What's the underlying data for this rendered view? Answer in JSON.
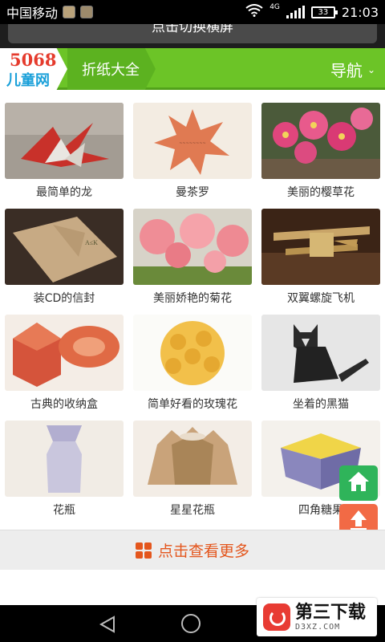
{
  "status_bar": {
    "carrier": "中国移动",
    "network": "4G",
    "battery": "33",
    "time": "21:03"
  },
  "rotate_banner": {
    "label": "点击切换横屏"
  },
  "header": {
    "logo_number": "5068",
    "logo_text": "儿童网",
    "section_title": "折纸大全",
    "nav_label": "导航"
  },
  "items": [
    {
      "title": "最简单的龙",
      "icon": "origami-dragon-image"
    },
    {
      "title": "曼茶罗",
      "icon": "origami-star-image"
    },
    {
      "title": "美丽的樱草花",
      "icon": "origami-primrose-image"
    },
    {
      "title": "装CD的信封",
      "icon": "cd-envelope-image"
    },
    {
      "title": "美丽娇艳的菊花",
      "icon": "origami-chrysanthemum-image"
    },
    {
      "title": "双翼螺旋飞机",
      "icon": "origami-biplane-image"
    },
    {
      "title": "古典的收纳盒",
      "icon": "origami-box-image"
    },
    {
      "title": "简单好看的玫瑰花",
      "icon": "origami-rose-ball-image"
    },
    {
      "title": "坐着的黑猫",
      "icon": "origami-black-cat-image"
    },
    {
      "title": "花瓶",
      "icon": "origami-vase-image"
    },
    {
      "title": "星星花瓶",
      "icon": "origami-star-vase-image"
    },
    {
      "title": "四角糖果",
      "icon": "origami-candy-box-image"
    }
  ],
  "more": {
    "label": "点击查看更多"
  },
  "watermark": {
    "title": "第三下载",
    "domain": "D3XZ.COM"
  },
  "colors": {
    "header_green": "#6cc427",
    "accent_orange": "#e4561d",
    "home_fab": "#2fb45a",
    "top_fab": "#f26a45"
  }
}
